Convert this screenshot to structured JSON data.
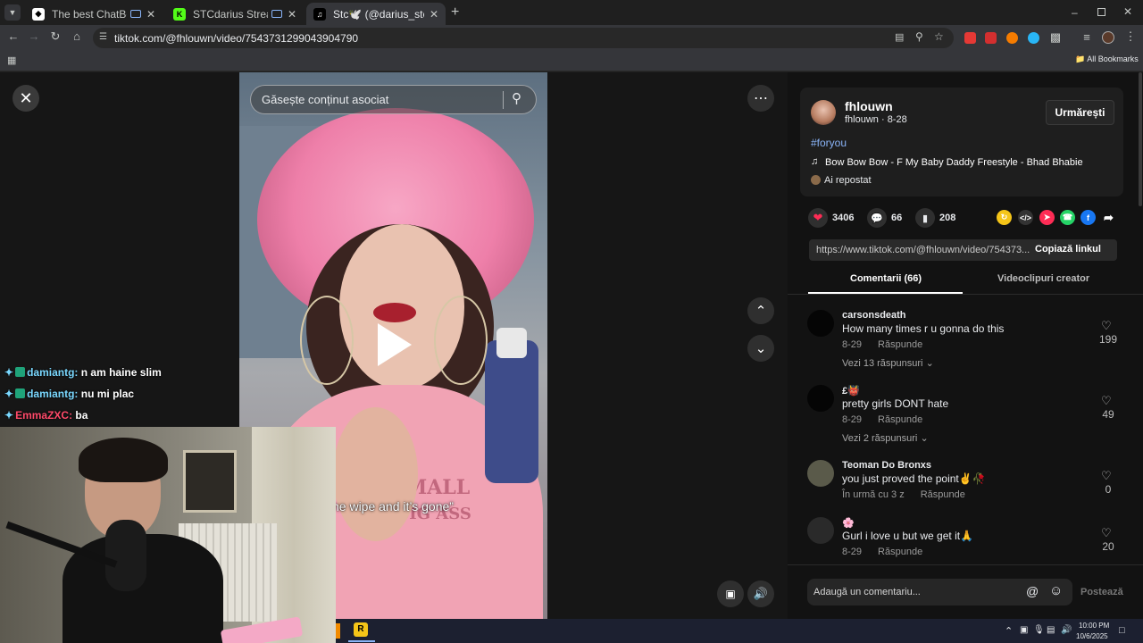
{
  "browser": {
    "tabs": [
      {
        "title": "The best ChatBot and Widg",
        "active": false
      },
      {
        "title": "STCdarius Stream - Watch L",
        "active": false
      },
      {
        "title": "Stc🕊️ (@darius_stc) | TikTok",
        "active": true
      }
    ],
    "new_tab_symbol": "+",
    "url": "tiktok.com/@fhlouwn/video/7543731299043904790",
    "bookmarks_label": "All Bookmarks"
  },
  "video": {
    "search_placeholder": "Găsește conținut asociat",
    "caption": "he wipe and it’s gone”",
    "shirt_text_1": "SMALL",
    "shirt_text_2": "BIG ASS"
  },
  "post": {
    "display_name": "fhlouwn",
    "handle_date": "fhlouwn · 8-28",
    "follow_label": "Urmărești",
    "hashtag": "#foryou",
    "music": "Bow Bow Bow - F My Baby Daddy Freestyle - Bhad Bhabie",
    "reposted": "Ai repostat",
    "likes": "3406",
    "comments": "66",
    "saves": "208",
    "link": "https://www.tiktok.com/@fhlouwn/video/754373...",
    "copy_label": "Copiază linkul",
    "tab_comments": "Comentarii (66)",
    "tab_creator": "Videoclipuri creator"
  },
  "comments": [
    {
      "user": "carsonsdeath",
      "text": "How many times r u gonna do this",
      "date": "8-29",
      "reply": "Răspunde",
      "more": "Vezi 13 răspunsuri",
      "likes": "199"
    },
    {
      "user": "£👹",
      "text": "pretty girls DONT hate",
      "date": "8-29",
      "reply": "Răspunde",
      "more": "Vezi 2 răspunsuri",
      "likes": "49"
    },
    {
      "user": "Teoman Do Bronxs",
      "text": "you just proved the point✌️🥀",
      "date": "În urmă cu 3 z",
      "reply": "Răspunde",
      "more": "",
      "likes": "0"
    },
    {
      "user": "🌸",
      "text": "Gurl i love u but we get it🙏",
      "date": "8-29",
      "reply": "Răspunde",
      "more": "",
      "likes": "20"
    }
  ],
  "comment_input": {
    "placeholder": "Adaugă un comentariu...",
    "post_label": "Postează"
  },
  "chat": [
    {
      "user": "damiantg:",
      "message": "n am haine slim",
      "user_color": "#7ad8ff"
    },
    {
      "user": "damiantg:",
      "message": "nu mi plac",
      "user_color": "#7ad8ff"
    },
    {
      "user": "EmmaZXC:",
      "message": "ba",
      "user_color": "#ff4a6a"
    }
  ],
  "taskbar": {
    "time": "10:00 PM",
    "date": "10/6/2025"
  },
  "colors": {
    "like_red": "#fe2c55",
    "link_blue": "#8ab4f8"
  }
}
